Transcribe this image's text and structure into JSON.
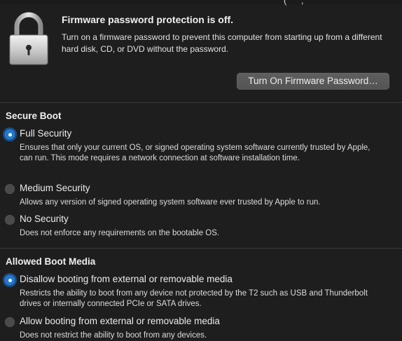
{
  "firmware": {
    "title": "Firmware password protection is off.",
    "description": "Turn on a firmware password to prevent this computer from starting up from a different hard disk, CD, or DVD without the password.",
    "button_label": "Turn On Firmware Password…",
    "icon": "lock-icon"
  },
  "secure_boot": {
    "title": "Secure Boot",
    "options": [
      {
        "label": "Full Security",
        "description": "Ensures that only your current OS, or signed operating system software currently trusted by Apple, can run. This mode requires a network connection at software installation time.",
        "selected": true
      },
      {
        "label": "Medium Security",
        "description": "Allows any version of signed operating system software ever trusted by Apple to run.",
        "selected": false
      },
      {
        "label": "No Security",
        "description": "Does not enforce any requirements on the bootable OS.",
        "selected": false
      }
    ]
  },
  "boot_media": {
    "title": "Allowed Boot Media",
    "options": [
      {
        "label": "Disallow booting from external or removable media",
        "description": "Restricts the ability to boot from any device not protected by the T2 such as USB and Thunderbolt drives or internally connected PCIe or SATA drives.",
        "selected": true
      },
      {
        "label": "Allow booting from external or removable media",
        "description": "Does not restrict the ability to boot from any devices.",
        "selected": false
      }
    ]
  },
  "colors": {
    "background": "#1e1e1e",
    "accent": "#1f78d1",
    "button": "#5a5a5a"
  }
}
